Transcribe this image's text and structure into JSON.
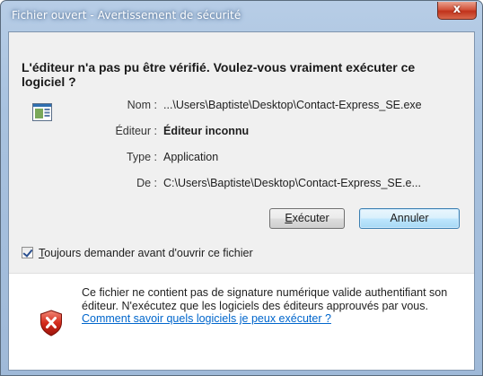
{
  "window": {
    "title": "Fichier ouvert - Avertissement de sécurité",
    "close_glyph": "x"
  },
  "heading": "L'éditeur n'a pas pu être vérifié. Voulez-vous vraiment exécuter ce logiciel ?",
  "file_icon": "application-icon",
  "details": {
    "nom_label": "Nom :",
    "nom_value": "...\\Users\\Baptiste\\Desktop\\Contact-Express_SE.exe",
    "editeur_label": "Éditeur :",
    "editeur_value": "Éditeur inconnu",
    "type_label": "Type :",
    "type_value": "Application",
    "de_label": "De :",
    "de_value": "C:\\Users\\Baptiste\\Desktop\\Contact-Express_SE.e..."
  },
  "buttons": {
    "run_first": "E",
    "run_rest": "xécuter",
    "cancel": "Annuler"
  },
  "checkbox": {
    "checked": true,
    "label_first": "T",
    "label_rest": "oujours demander avant d'ouvrir ce fichier"
  },
  "warning": {
    "icon": "shield-error-icon",
    "text": "Ce fichier ne contient pas de signature numérique valide authentifiant son éditeur. N'exécutez que les logiciels des éditeurs approuvés par vous. ",
    "link": "Comment savoir quels logiciels je peux exécuter ?"
  }
}
